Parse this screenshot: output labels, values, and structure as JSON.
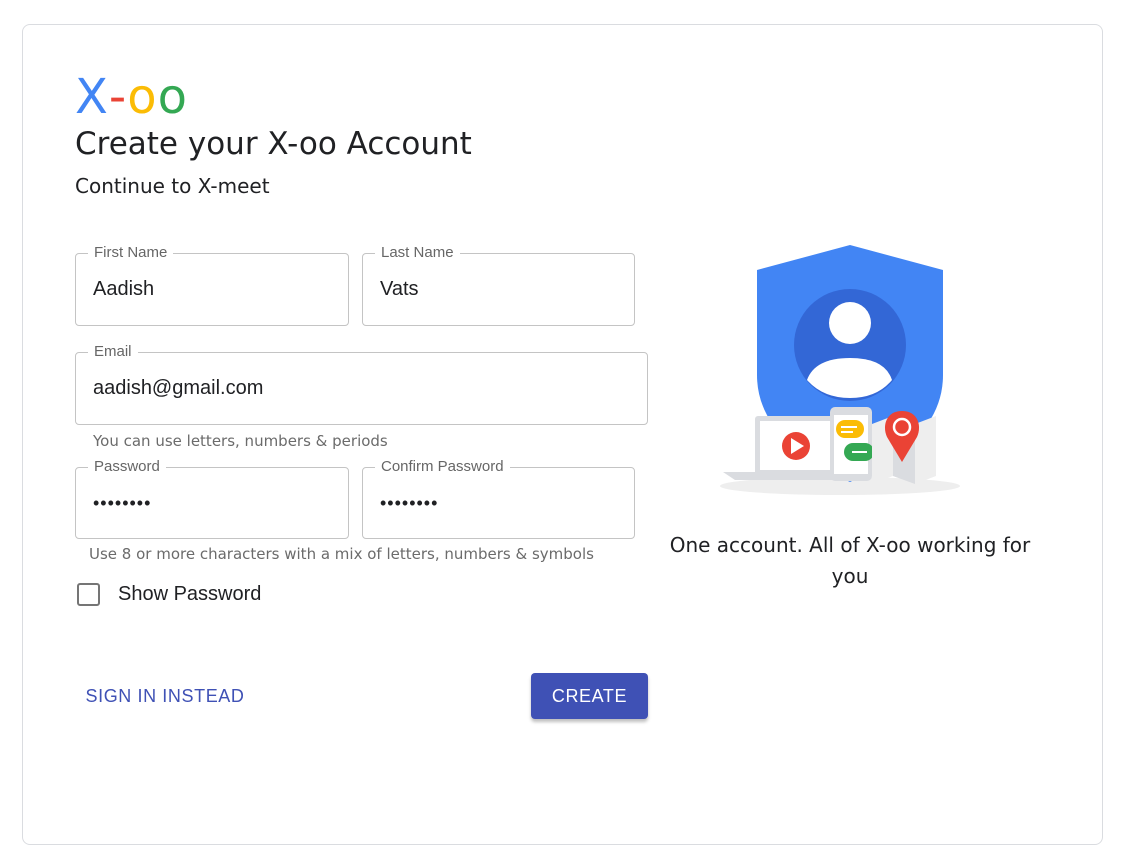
{
  "brand": {
    "logo_letters": [
      "X",
      "-",
      "o",
      "o"
    ],
    "logo_colors": [
      "#4285f4",
      "#ea4335",
      "#fbbc05",
      "#34a853"
    ]
  },
  "header": {
    "title": "Create your X-oo Account",
    "subtitle": "Continue to X-meet"
  },
  "form": {
    "first_name": {
      "label": "First Name",
      "value": "Aadish"
    },
    "last_name": {
      "label": "Last Name",
      "value": "Vats"
    },
    "email": {
      "label": "Email",
      "value": "aadish@gmail.com",
      "helper": "You can use letters, numbers & periods"
    },
    "password": {
      "label": "Password",
      "value": "password"
    },
    "confirm_password": {
      "label": "Confirm Password",
      "value": "password"
    },
    "password_helper": "Use 8 or more characters with a mix of letters, numbers & symbols",
    "show_password": {
      "label": "Show Password",
      "checked": false
    }
  },
  "actions": {
    "sign_in_label": "SIGN IN INSTEAD",
    "create_label": "CREATE"
  },
  "side": {
    "tagline": "One account. All of X-oo working for you",
    "illustration_icon": "account-shield-icon"
  },
  "colors": {
    "accent": "#3f51b5",
    "shield": "#4285f4",
    "avatar_bg": "#3367d6"
  }
}
